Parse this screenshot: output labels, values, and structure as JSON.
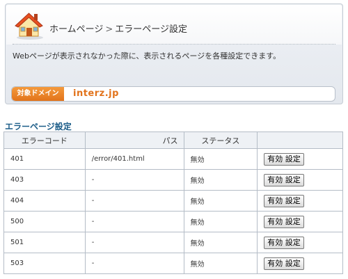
{
  "header": {
    "breadcrumb_home": "ホームページ",
    "breadcrumb_separator": ">",
    "breadcrumb_current": "エラーページ設定",
    "description": "Webページが表示されなかった際に、表示されるページを各種設定できます。",
    "home_icon": "house-icon"
  },
  "domain": {
    "label": "対象ドメイン",
    "value": "interz.jp"
  },
  "section": {
    "title": "エラーページ設定"
  },
  "table": {
    "headers": [
      "エラーコード",
      "パス",
      "ステータス",
      ""
    ],
    "rows": [
      {
        "code": "401",
        "path": "/error/401.html",
        "status": "無効",
        "button": "有効 設定"
      },
      {
        "code": "403",
        "path": "-",
        "status": "無効",
        "button": "有効 設定"
      },
      {
        "code": "404",
        "path": "-",
        "status": "無効",
        "button": "有効 設定"
      },
      {
        "code": "500",
        "path": "-",
        "status": "無効",
        "button": "有効 設定"
      },
      {
        "code": "501",
        "path": "-",
        "status": "無効",
        "button": "有効 設定"
      },
      {
        "code": "503",
        "path": "-",
        "status": "無効",
        "button": "有効 設定"
      }
    ]
  },
  "colors": {
    "accent_orange": "#e2731b",
    "section_blue": "#1b5c88",
    "border": "#b4bcc6"
  }
}
